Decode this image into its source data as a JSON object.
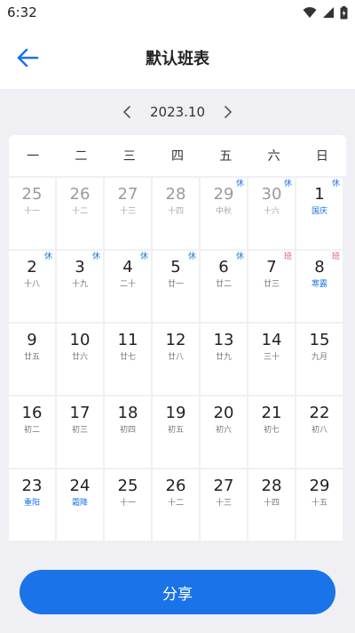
{
  "status_bar": {
    "time": "6:32",
    "icons": [
      "wifi-icon",
      "signal-icon",
      "battery-icon"
    ]
  },
  "app_bar": {
    "title": "默认班表",
    "back_icon": "arrow-left-icon"
  },
  "month_nav": {
    "prev_icon": "chevron-left-icon",
    "month": "2023.10",
    "next_icon": "chevron-right-icon"
  },
  "weekdays": [
    "一",
    "二",
    "三",
    "四",
    "五",
    "六",
    "日"
  ],
  "days": [
    {
      "day": "25",
      "lunar": "十一",
      "dim": true,
      "tag": ""
    },
    {
      "day": "26",
      "lunar": "十二",
      "dim": true,
      "tag": ""
    },
    {
      "day": "27",
      "lunar": "十三",
      "dim": true,
      "tag": ""
    },
    {
      "day": "28",
      "lunar": "十四",
      "dim": true,
      "tag": ""
    },
    {
      "day": "29",
      "lunar": "中秋",
      "dim": true,
      "tag": "休",
      "festival": true
    },
    {
      "day": "30",
      "lunar": "十六",
      "dim": true,
      "tag": "休"
    },
    {
      "day": "1",
      "lunar": "国庆",
      "tag": "休",
      "festival": true
    },
    {
      "day": "2",
      "lunar": "十八",
      "tag": "休"
    },
    {
      "day": "3",
      "lunar": "十九",
      "tag": "休"
    },
    {
      "day": "4",
      "lunar": "二十",
      "tag": "休"
    },
    {
      "day": "5",
      "lunar": "廿一",
      "tag": "休"
    },
    {
      "day": "6",
      "lunar": "廿二",
      "tag": "休"
    },
    {
      "day": "7",
      "lunar": "廿三",
      "tag": "班",
      "tag_type": "work"
    },
    {
      "day": "8",
      "lunar": "寒露",
      "tag": "班",
      "tag_type": "work",
      "festival": true
    },
    {
      "day": "9",
      "lunar": "廿五",
      "tag": ""
    },
    {
      "day": "10",
      "lunar": "廿六",
      "tag": ""
    },
    {
      "day": "11",
      "lunar": "廿七",
      "tag": ""
    },
    {
      "day": "12",
      "lunar": "廿八",
      "tag": ""
    },
    {
      "day": "13",
      "lunar": "廿九",
      "tag": ""
    },
    {
      "day": "14",
      "lunar": "三十",
      "tag": ""
    },
    {
      "day": "15",
      "lunar": "九月",
      "tag": ""
    },
    {
      "day": "16",
      "lunar": "初二",
      "tag": ""
    },
    {
      "day": "17",
      "lunar": "初三",
      "tag": ""
    },
    {
      "day": "18",
      "lunar": "初四",
      "tag": ""
    },
    {
      "day": "19",
      "lunar": "初五",
      "tag": ""
    },
    {
      "day": "20",
      "lunar": "初六",
      "tag": ""
    },
    {
      "day": "21",
      "lunar": "初七",
      "tag": ""
    },
    {
      "day": "22",
      "lunar": "初八",
      "tag": ""
    },
    {
      "day": "23",
      "lunar": "重阳",
      "tag": "",
      "festival": true
    },
    {
      "day": "24",
      "lunar": "霜降",
      "tag": "",
      "festival": true
    },
    {
      "day": "25",
      "lunar": "十一",
      "tag": ""
    },
    {
      "day": "26",
      "lunar": "十二",
      "tag": ""
    },
    {
      "day": "27",
      "lunar": "十三",
      "tag": ""
    },
    {
      "day": "28",
      "lunar": "十四",
      "tag": ""
    },
    {
      "day": "29",
      "lunar": "十五",
      "tag": ""
    }
  ],
  "share_button": {
    "label": "分享"
  },
  "colors": {
    "accent": "#1a73e8",
    "work_tag": "#e05a6e",
    "background": "#f0f0f4"
  }
}
